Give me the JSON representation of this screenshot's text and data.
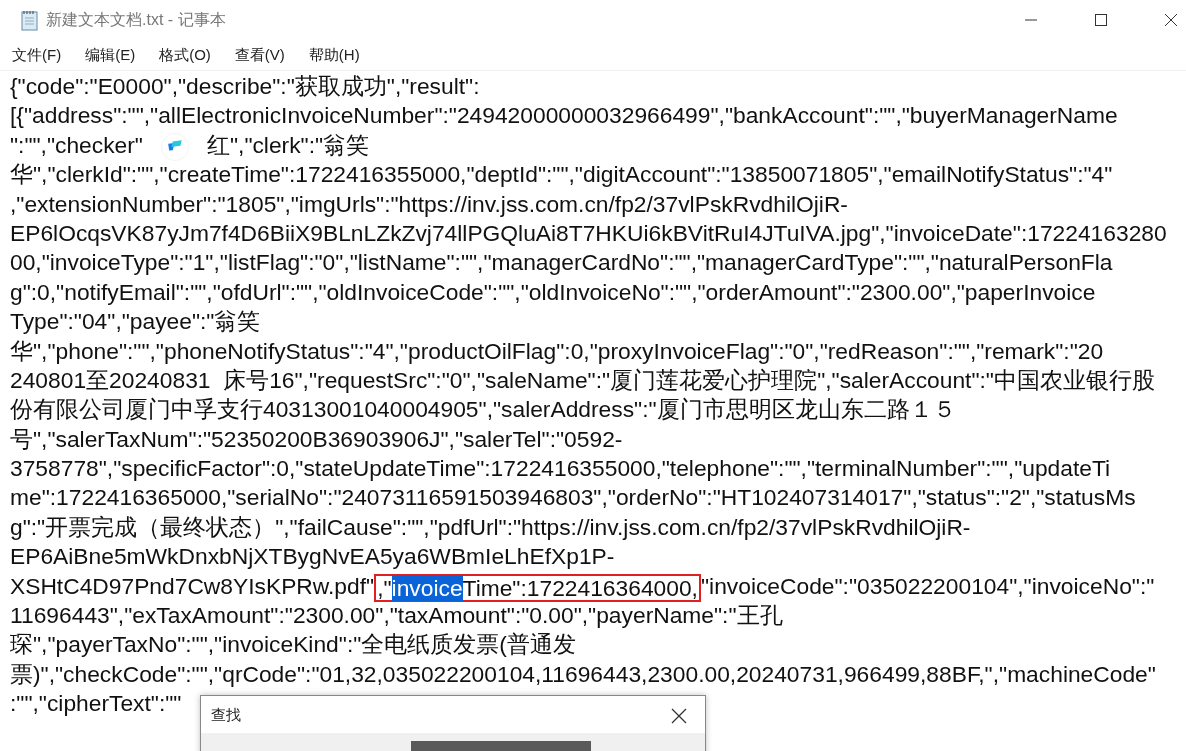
{
  "window": {
    "title": "新建文本文档.txt - 记事本"
  },
  "menu": [
    {
      "label": "文件(F)"
    },
    {
      "label": "编辑(E)"
    },
    {
      "label": "格式(O)"
    },
    {
      "label": "查看(V)"
    },
    {
      "label": "帮助(H)"
    }
  ],
  "editor": {
    "lines": [
      [
        {
          "kind": "text",
          "text": "{\"code\":\"E0000\",\"describe\":\"获取成功\",\"result\":"
        }
      ],
      [
        {
          "kind": "text",
          "text": "[{\"address\":\"\",\"allElectronicInvoiceNumber\":\"24942000000032966499\",\"bankAccount\":\"\",\"buyerManagerName"
        }
      ],
      [
        {
          "kind": "text",
          "text": "\":\"\",\"checker\""
        },
        {
          "kind": "covered"
        },
        {
          "kind": "text",
          "text": "红\",\"clerk\":\"翁笑"
        }
      ],
      [
        {
          "kind": "text",
          "text": "华\",\"clerkId\":\"\",\"createTime\":1722416355000,\"deptId\":\"\",\"digitAccount\":\"13850071805\",\"emailNotifyStatus\":\"4\""
        }
      ],
      [
        {
          "kind": "text",
          "text": ",\"extensionNumber\":\"1805\",\"imgUrls\":\"https://inv.jss.com.cn/fp2/37vlPskRvdhilOjiR-"
        }
      ],
      [
        {
          "kind": "text",
          "text": "EP6lOcqsVK87yJm7f4D6BiiX9BLnLZkZvj74llPGQluAi8T7HKUi6kBVitRuI4JTuIVA.jpg\",\"invoiceDate\":17224163280"
        }
      ],
      [
        {
          "kind": "text",
          "text": "00,\"invoiceType\":\"1\",\"listFlag\":\"0\",\"listName\":\"\",\"managerCardNo\":\"\",\"managerCardType\":\"\",\"naturalPersonFla"
        }
      ],
      [
        {
          "kind": "text",
          "text": "g\":0,\"notifyEmail\":\"\",\"ofdUrl\":\"\",\"oldInvoiceCode\":\"\",\"oldInvoiceNo\":\"\",\"orderAmount\":\"2300.00\",\"paperInvoice"
        }
      ],
      [
        {
          "kind": "text",
          "text": "Type\":\"04\",\"payee\":\"翁笑"
        }
      ],
      [
        {
          "kind": "text",
          "text": "华\",\"phone\":\"\",\"phoneNotifyStatus\":\"4\",\"productOilFlag\":0,\"proxyInvoiceFlag\":\"0\",\"redReason\":\"\",\"remark\":\"20"
        }
      ],
      [
        {
          "kind": "text",
          "text": "240801至20240831  床号16\",\"requestSrc\":\"0\",\"saleName\":\"厦门莲花爱心护理院\",\"salerAccount\":\"中国农业银行股"
        }
      ],
      [
        {
          "kind": "text",
          "text": "份有限公司厦门中孚支行40313001040004905\",\"salerAddress\":\"厦门市思明区龙山东二路１５"
        }
      ],
      [
        {
          "kind": "text",
          "text": "号\",\"salerTaxNum\":\"52350200B36903906J\",\"salerTel\":\"0592-"
        }
      ],
      [
        {
          "kind": "text",
          "text": "3758778\",\"specificFactor\":0,\"stateUpdateTime\":1722416355000,\"telephone\":\"\",\"terminalNumber\":\"\",\"updateTi"
        }
      ],
      [
        {
          "kind": "text",
          "text": "me\":1722416365000,\"serialNo\":\"24073116591503946803\",\"orderNo\":\"HT102407314017\",\"status\":\"2\",\"statusMs"
        }
      ],
      [
        {
          "kind": "text",
          "text": "g\":\"开票完成（最终状态）\",\"failCause\":\"\",\"pdfUrl\":\"https://inv.jss.com.cn/fp2/37vlPskRvdhilOjiR-"
        }
      ],
      [
        {
          "kind": "text",
          "text": "EP6AiBne5mWkDnxbNjXTBygNvEA5ya6WBmIeLhEfXp1P-"
        }
      ],
      [
        {
          "kind": "text",
          "text": "XSHtC4D97Pnd7Cw8YIsKPRw.pdf\""
        },
        {
          "kind": "box",
          "parts": [
            {
              "text": ",\"",
              "selected": false
            },
            {
              "text": "invoice",
              "selected": true
            },
            {
              "text": "Time\":1722416364000,",
              "selected": false
            }
          ]
        },
        {
          "kind": "text",
          "text": "\"invoiceCode\":\"035022200104\",\"invoiceNo\":\""
        }
      ],
      [
        {
          "kind": "text",
          "text": "11696443\",\"exTaxAmount\":\"2300.00\",\"taxAmount\":\"0.00\",\"payerName\":\"王孔"
        }
      ],
      [
        {
          "kind": "text",
          "text": "琛\",\"payerTaxNo\":\"\",\"invoiceKind\":\"全电纸质发票(普通发"
        }
      ],
      [
        {
          "kind": "text",
          "text": "票)\",\"checkCode\":\"\",\"qrCode\":\"01,32,035022200104,11696443,2300.00,20240731,966499,88BF,\",\"machineCode\""
        }
      ],
      [
        {
          "kind": "text",
          "text": ":\"\",\"cipherText\":\"\""
        }
      ]
    ]
  },
  "find_dialog": {
    "title": "查找"
  }
}
